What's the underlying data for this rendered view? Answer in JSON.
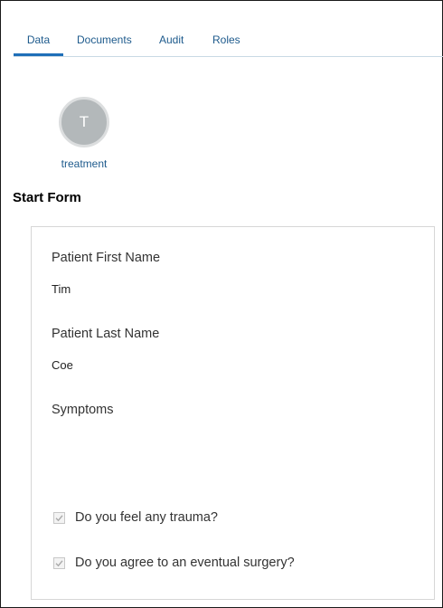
{
  "tabs": {
    "data": "Data",
    "documents": "Documents",
    "audit": "Audit",
    "roles": "Roles",
    "active": "Data"
  },
  "task": {
    "avatar_initial": "T",
    "name": "treatment"
  },
  "form": {
    "title": "Start Form",
    "patient_first_name": {
      "label": "Patient First Name",
      "value": "Tim"
    },
    "patient_last_name": {
      "label": "Patient Last Name",
      "value": "Coe"
    },
    "symptoms": {
      "label": "Symptoms",
      "value": ""
    },
    "trauma_question": {
      "label": "Do you feel any trauma?",
      "checked": true,
      "disabled": true
    },
    "surgery_question": {
      "label": "Do you agree to an eventual surgery?",
      "checked": true,
      "disabled": true
    }
  },
  "colors": {
    "accent": "#1f6fb8",
    "link_text": "#1d5a8c",
    "avatar_bg": "#b3b8ba"
  }
}
